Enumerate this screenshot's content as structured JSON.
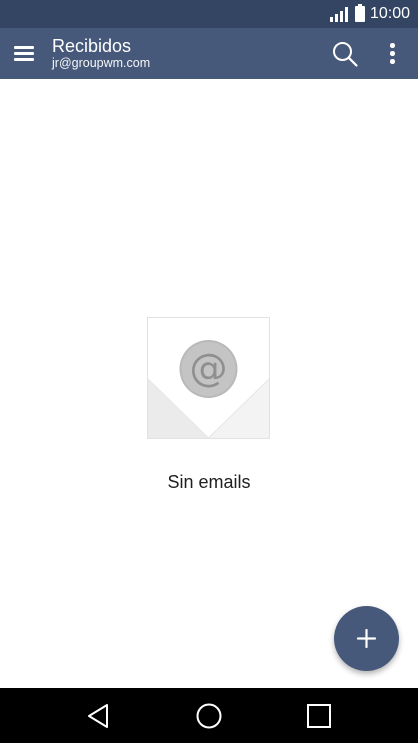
{
  "status_bar": {
    "time": "10:00",
    "signal_icon": "signal-icon",
    "battery_icon": "battery-icon"
  },
  "app_bar": {
    "menu_icon": "hamburger-menu-icon",
    "title": "Recibidos",
    "account": "jr@groupwm.com",
    "search_icon": "search-icon",
    "overflow_icon": "more-vertical-icon"
  },
  "empty_state": {
    "icon": "email-at-envelope-icon",
    "message": "Sin emails"
  },
  "fab": {
    "icon": "plus-icon"
  },
  "nav_bar": {
    "back_icon": "back-triangle-icon",
    "home_icon": "home-circle-icon",
    "recents_icon": "recents-square-icon"
  },
  "colors": {
    "status_bar": "#344563",
    "app_bar": "#47597a",
    "fab": "#47597a",
    "nav_bar": "#000000",
    "background": "#ffffff"
  }
}
